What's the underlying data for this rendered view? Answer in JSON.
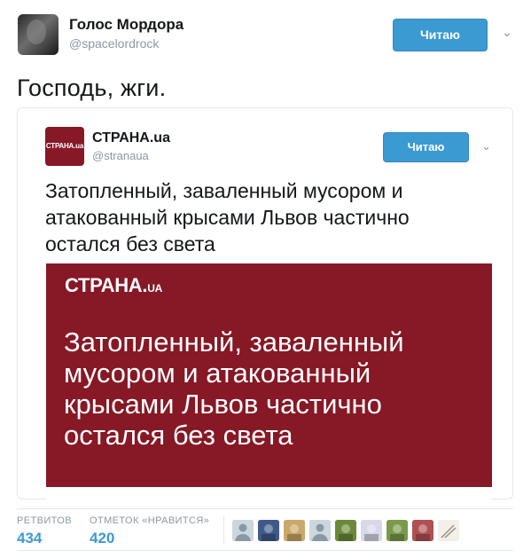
{
  "tweet": {
    "author_name": "Голос Мордора",
    "author_handle": "@spacelordrock",
    "follow_label": "Читаю",
    "text": "Господь, жги."
  },
  "quoted": {
    "logo_text": "СТРАНА.ua",
    "author_name": "СТРАНА.ua",
    "author_handle": "@stranaua",
    "follow_label": "Читаю",
    "text": "Затопленный, заваленный мусором и атакованный крысами Львов частично остался без света",
    "media": {
      "logo_main": "СТРАНА.",
      "logo_suffix": "UA",
      "headline": "Затопленный, заваленный мусором и атакованный крысами Львов частично остался без света",
      "bg_color": "#871825"
    }
  },
  "stats": {
    "retweets_label": "РЕТВИТОВ",
    "retweets_value": "434",
    "likes_label": "ОТМЕТОК «НРАВИТСЯ»",
    "likes_value": "420"
  },
  "likers": [
    {
      "icon": "default-avatar-icon",
      "color": "#8899a6"
    },
    {
      "icon": "emblem-avatar-icon",
      "color": "#3f5a8a"
    },
    {
      "icon": "figure-avatar-icon",
      "color": "#c9a86a"
    },
    {
      "icon": "default-avatar-icon",
      "color": "#8899a6"
    },
    {
      "icon": "photo-avatar-icon",
      "color": "#6a8a3a"
    },
    {
      "icon": "photo-avatar-icon",
      "color": "#d8d8e8"
    },
    {
      "icon": "photo-avatar-icon",
      "color": "#7a9a4a"
    },
    {
      "icon": "photo-avatar-icon",
      "color": "#b05050"
    },
    {
      "icon": "sketch-avatar-icon",
      "color": "#e8e0d8"
    }
  ],
  "colors": {
    "accent": "#3b9ad1",
    "brand": "#871825"
  }
}
